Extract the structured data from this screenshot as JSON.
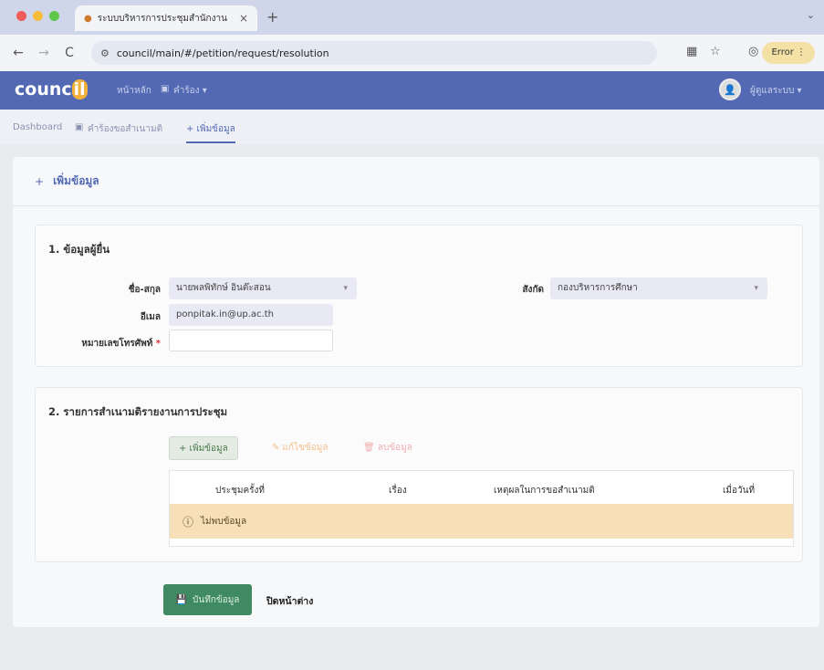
{
  "browser": {
    "tab_title": "ระบบบริหารการประชุมสำนักงาน",
    "tab_close": "×",
    "new_tab": "+",
    "url": "council/main/#/petition/request/resolution",
    "error_label": "Error",
    "nav_back": "←",
    "nav_forward": "→",
    "nav_reload": "C"
  },
  "app": {
    "logo_prefix": "counc",
    "logo_highlight": "il",
    "nav": {
      "home": "หน้าหลัก",
      "requests": "คำร้อง ▾"
    },
    "username": "ผู้ดูแลระบบ ▾",
    "avatar": "👤"
  },
  "breadcrumb": {
    "dashboard": "Dashboard",
    "requests": "คำร้องขอสำเนามติ",
    "add": "+ เพิ่มข้อมูล"
  },
  "page": {
    "title": "เพิ่มข้อมูล",
    "title_icon": "+"
  },
  "section1": {
    "title": "1. ข้อมูลผู้ยื่น",
    "name_label": "ชื่อ-สกุล",
    "name_value": "นายพลพิทักษ์ อินต๊ะสอน",
    "email_label": "อีเมล",
    "email_value": "ponpitak.in@up.ac.th",
    "phone_label": "หมายเลขโทรศัพท์",
    "phone_required": "*",
    "affiliation_label": "สังกัด",
    "affiliation_value": "กองบริหารการศึกษา"
  },
  "section2": {
    "title": "2. รายการสำเนามติรายงานการประชุม",
    "add_button": "+ เพิ่มข้อมูล",
    "edit_button": "✎ แก้ไขข้อมูล",
    "delete_button": "🗑 ลบข้อมูล",
    "columns": [
      "ประชุมครั้งที่",
      "เรื่อง",
      "เหตุผลในการขอสำเนามติ",
      "เมื่อวันที่"
    ],
    "empty_message": "ไม่พบข้อมูล",
    "empty_icon": "ⓘ"
  },
  "actions": {
    "save_label": "บันทึกข้อมูล",
    "save_icon": "💾",
    "close_label": "ปิดหน้าต่าง"
  }
}
